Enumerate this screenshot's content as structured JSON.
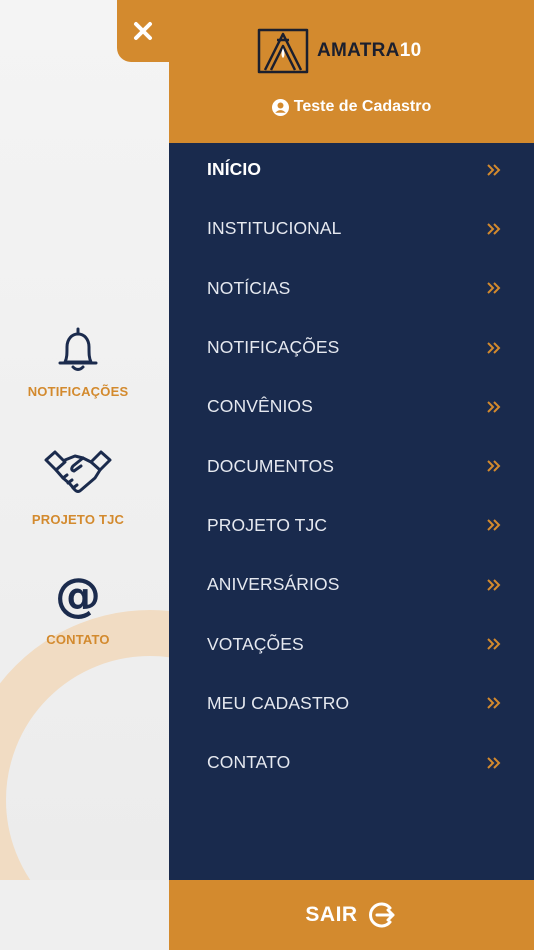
{
  "shortcuts": [
    {
      "label": "NOTIFICAÇÕES",
      "icon": "bell-icon"
    },
    {
      "label": "PROJETO TJC",
      "icon": "handshake-icon"
    },
    {
      "label": "CONTATO",
      "icon": "at-icon",
      "glyph": "@"
    }
  ],
  "close_icon": "close-icon",
  "header": {
    "logo_text": "AMATRA",
    "logo_number": "10",
    "user_name": "Teste de Cadastro"
  },
  "menu": {
    "items": [
      {
        "label": "INÍCIO",
        "active": true
      },
      {
        "label": "INSTITUCIONAL"
      },
      {
        "label": "NOTÍCIAS"
      },
      {
        "label": "NOTIFICAÇÕES"
      },
      {
        "label": "CONVÊNIOS"
      },
      {
        "label": "DOCUMENTOS"
      },
      {
        "label": "PROJETO TJC"
      },
      {
        "label": "ANIVERSÁRIOS"
      },
      {
        "label": "VOTAÇÕES"
      },
      {
        "label": "MEU CADASTRO"
      },
      {
        "label": "CONTATO"
      }
    ]
  },
  "logout": {
    "label": "SAIR",
    "icon": "logout-icon"
  },
  "colors": {
    "accent": "#d38a2e",
    "navy": "#192a4d",
    "ring": "#f1dcc3"
  }
}
